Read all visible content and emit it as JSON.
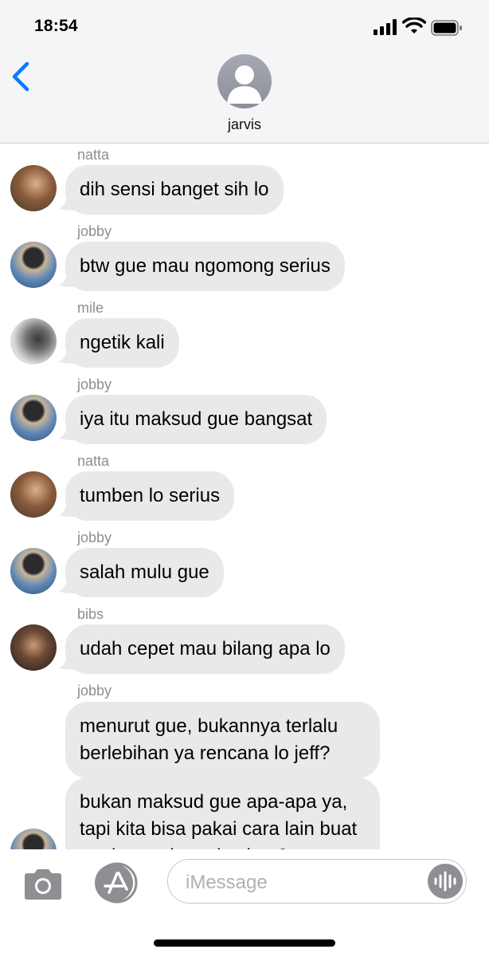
{
  "status_bar": {
    "time": "18:54"
  },
  "header": {
    "contact_name": "jarvis"
  },
  "messages": [
    {
      "sender": "natta",
      "text": "dih sensi banget sih lo"
    },
    {
      "sender": "jobby",
      "text": "btw gue mau ngomong serius"
    },
    {
      "sender": "mile",
      "text": "ngetik kali"
    },
    {
      "sender": "jobby",
      "text": "iya itu maksud gue bangsat"
    },
    {
      "sender": "natta",
      "text": "tumben lo serius"
    },
    {
      "sender": "jobby",
      "text": "salah mulu gue"
    },
    {
      "sender": "bibs",
      "text": "udah cepet mau bilang apa lo"
    },
    {
      "sender": "jobby",
      "text": "menurut gue, bukannya terlalu berlebihan ya rencana lo jeff?"
    },
    {
      "sender": "",
      "text": "bukan maksud gue apa-apa ya, tapi kita bisa pakai cara lain buat ngehancurin carlos kan?"
    }
  ],
  "composer": {
    "placeholder": "iMessage"
  },
  "colors": {
    "accent": "#0a7aff",
    "bubble": "#e9e9eb",
    "secondary_text": "#8e8e93"
  }
}
